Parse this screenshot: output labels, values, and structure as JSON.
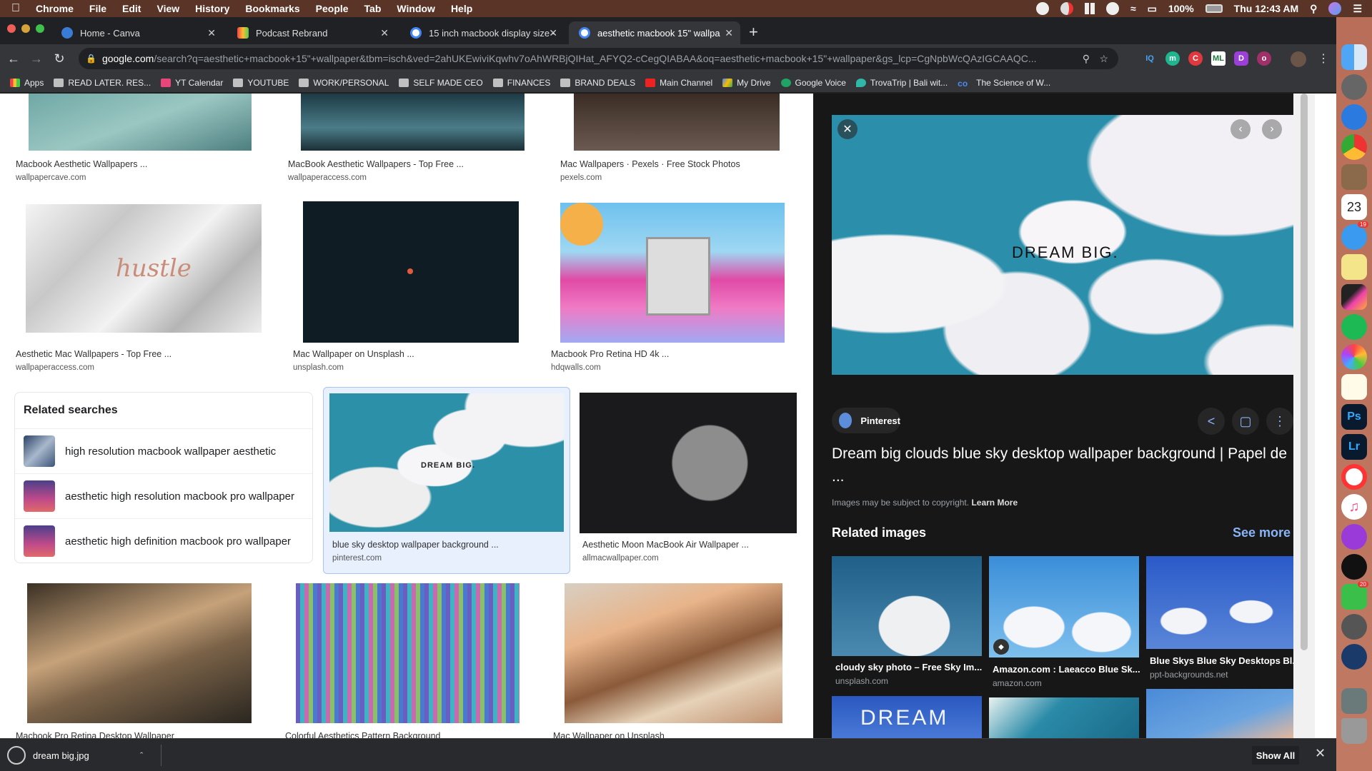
{
  "menubar": {
    "app": "Chrome",
    "items": [
      "File",
      "Edit",
      "View",
      "History",
      "Bookmarks",
      "People",
      "Tab",
      "Window",
      "Help"
    ],
    "battery": "100%",
    "clock": "Thu 12:43 AM"
  },
  "tabs": [
    {
      "label": "Home - Canva",
      "favicon": "canva-icon",
      "color": "#3a7bd5"
    },
    {
      "label": "Podcast Rebrand",
      "favicon": "monday-icon",
      "color": "#e8a33d"
    },
    {
      "label": "15 inch macbook display size -",
      "favicon": "google-icon",
      "color": "#ffffff"
    },
    {
      "label": "aesthetic macbook 15\" wallpa",
      "favicon": "google-icon",
      "color": "#ffffff",
      "active": true
    }
  ],
  "omnibox": {
    "host": "google.com",
    "path": "/search?q=aesthetic+macbook+15\"+wallpaper&tbm=isch&ved=2ahUKEwiviKqwhv7oAhWRBjQIHat_AFYQ2-cCegQIABAA&oq=aesthetic+macbook+15\"+wallpaper&gs_lcp=CgNpbWcQAzIGCAAQC..."
  },
  "extensions": [
    {
      "name": "iq-extension",
      "label": "IQ",
      "color": "#35363a",
      "fg": "#4aa3f0"
    },
    {
      "name": "m-extension",
      "label": "m",
      "color": "#1fb58f",
      "fg": "#fff"
    },
    {
      "name": "c-extension",
      "label": "C",
      "color": "#e0383e",
      "fg": "#fff"
    },
    {
      "name": "ml-extension",
      "label": "ML",
      "color": "#ffffff",
      "fg": "#1a7a3a"
    },
    {
      "name": "d-extension",
      "label": "D",
      "color": "#9b3fd8",
      "fg": "#fff"
    },
    {
      "name": "o-extension",
      "label": "o",
      "color": "#a0306a",
      "fg": "#fff"
    }
  ],
  "bookmarks": [
    {
      "label": "Apps",
      "icon": "apps-grid-icon"
    },
    {
      "label": "READ LATER. RES...",
      "icon": "folder-icon"
    },
    {
      "label": "YT Calendar",
      "icon": "calendar-icon"
    },
    {
      "label": "YOUTUBE",
      "icon": "folder-icon"
    },
    {
      "label": "WORK/PERSONAL",
      "icon": "folder-icon"
    },
    {
      "label": "SELF MADE CEO",
      "icon": "folder-icon"
    },
    {
      "label": "FINANCES",
      "icon": "folder-icon"
    },
    {
      "label": "BRAND DEALS",
      "icon": "folder-icon"
    },
    {
      "label": "Main Channel",
      "icon": "youtube-icon"
    },
    {
      "label": "My Drive",
      "icon": "drive-icon"
    },
    {
      "label": "Google Voice",
      "icon": "voice-icon"
    },
    {
      "label": "TrovaTrip | Bali wit...",
      "icon": "location-pin-icon"
    },
    {
      "label": "The Science of W...",
      "icon": "link-icon"
    }
  ],
  "results": [
    {
      "title": "Macbook Aesthetic Wallpapers ...",
      "source": "wallpapercave.com"
    },
    {
      "title": "MacBook Aesthetic Wallpapers - Top Free ...",
      "source": "wallpaperaccess.com"
    },
    {
      "title": "Mac Wallpapers · Pexels · Free Stock Photos",
      "source": "pexels.com"
    },
    {
      "title": "Aesthetic Mac Wallpapers - Top Free ...",
      "source": "wallpaperaccess.com",
      "overlay": "hustle"
    },
    {
      "title": "Mac Wallpaper on Unsplash ...",
      "source": "unsplash.com"
    },
    {
      "title": "Macbook Pro Retina HD 4k ...",
      "source": "hdqwalls.com"
    },
    {
      "title": "blue sky desktop wallpaper background ...",
      "source": "pinterest.com",
      "overlay": "DREAM BIG."
    },
    {
      "title": "Aesthetic Moon MacBook Air Wallpaper ...",
      "source": "allmacwallpaper.com"
    },
    {
      "title": "Macbook Pro Retina Desktop Wallpaper",
      "source": ""
    },
    {
      "title": "Colorful Aesthetics Pattern Background",
      "source": ""
    },
    {
      "title": "Mac Wallpaper on Unsplash",
      "source": ""
    }
  ],
  "related_searches": {
    "heading": "Related searches",
    "items": [
      "high resolution macbook wallpaper aesthetic",
      "aesthetic high resolution macbook pro wallpaper",
      "aesthetic high definition macbook pro wallpaper"
    ]
  },
  "preview": {
    "image_text": "DREAM BIG.",
    "source_label": "Pinterest",
    "title": "Dream big clouds blue sky desktop wallpaper background | Papel de ...",
    "copyright": "Images may be subject to copyright.",
    "learn_more": "Learn More",
    "related_heading": "Related images",
    "see_more": "See more",
    "related": [
      {
        "title": "cloudy sky photo – Free Sky Im...",
        "source": "unsplash.com"
      },
      {
        "title": "Amazon.com : Laeacco Blue Sk...",
        "source": "amazon.com"
      },
      {
        "title": "Blue Skys Blue Sky Desktops Bl...",
        "source": "ppt-backgrounds.net"
      },
      {
        "title": "",
        "source": "",
        "overlay": "DREAM"
      },
      {
        "title": "",
        "source": ""
      },
      {
        "title": "",
        "source": ""
      }
    ]
  },
  "download_bar": {
    "filename": "dream big.jpg",
    "show_all": "Show All"
  },
  "dock": {
    "calendar_day": "23",
    "messages_badge": "19",
    "facetime_badge": "20",
    "ps_label": "Ps",
    "lr_label": "Lr"
  }
}
